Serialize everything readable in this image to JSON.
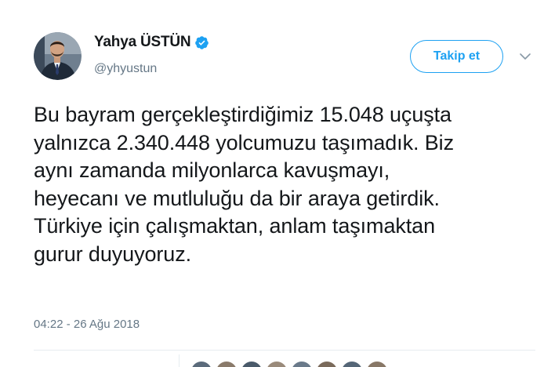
{
  "user": {
    "display_name": "Yahya ÜSTÜN",
    "handle": "@yhyustun",
    "verified": true
  },
  "follow_button": {
    "label": "Takip et"
  },
  "menu": {
    "icon": "chevron-down-icon"
  },
  "tweet": {
    "lines": [
      "Bu bayram gerçekleştirdiğimiz 15.048 uçuşta",
      "yalnızca 2.340.448 yolcumuzu taşımadık. Biz",
      "aynı zamanda milyonlarca kavuşmayı,",
      "heyecanı ve mutluluğu da bir araya getirdik.",
      "Türkiye için çalışmaktan, anlam taşımaktan",
      "gurur duyuyoruz."
    ],
    "timestamp": "04:22 - 26 Ağu 2018"
  },
  "colors": {
    "accent": "#1da1f2",
    "text": "#14171a",
    "secondary": "#657786",
    "divider": "#e6ecf0"
  }
}
